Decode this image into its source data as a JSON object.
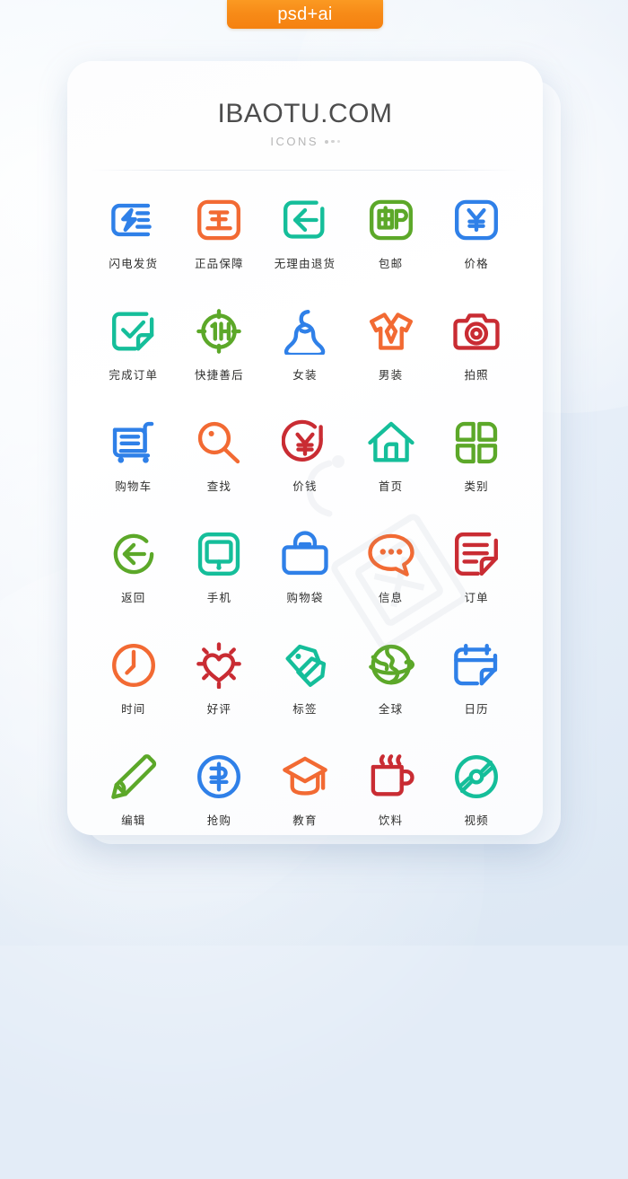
{
  "badge": {
    "label": "psd+ai",
    "color": "#f78b18"
  },
  "header": {
    "title": "IBAOTU.COM",
    "subtitle": "ICONS",
    "dots": "three-dots"
  },
  "palette": {
    "blue": "#2F80E8",
    "orange": "#F26A33",
    "teal": "#15BE9A",
    "green": "#5CA829",
    "red": "#C92C33"
  },
  "watermark": {
    "text": "图"
  },
  "grid": {
    "columns": 5,
    "rows": 6,
    "items": [
      {
        "label": "闪电发货",
        "icon": "flash-delivery-icon",
        "color": "#2F80E8"
      },
      {
        "label": "正品保障",
        "icon": "genuine-guarantee-icon",
        "color": "#F26A33"
      },
      {
        "label": "无理由退货",
        "icon": "return-arrow-icon",
        "color": "#15BE9A"
      },
      {
        "label": "包邮",
        "icon": "free-shipping-icon",
        "color": "#5CA829"
      },
      {
        "label": "价格",
        "icon": "price-yen-icon",
        "color": "#2F80E8"
      },
      {
        "label": "完成订单",
        "icon": "order-complete-icon",
        "color": "#15BE9A"
      },
      {
        "label": "快捷善后",
        "icon": "one-hour-icon",
        "color": "#5CA829"
      },
      {
        "label": "女装",
        "icon": "dress-icon",
        "color": "#2F80E8"
      },
      {
        "label": "男装",
        "icon": "shirt-icon",
        "color": "#F26A33"
      },
      {
        "label": "拍照",
        "icon": "camera-icon",
        "color": "#C92C33"
      },
      {
        "label": "购物车",
        "icon": "shopping-cart-icon",
        "color": "#2F80E8"
      },
      {
        "label": "查找",
        "icon": "search-icon",
        "color": "#F26A33"
      },
      {
        "label": "价钱",
        "icon": "yen-circle-icon",
        "color": "#C92C33"
      },
      {
        "label": "首页",
        "icon": "home-icon",
        "color": "#15BE9A"
      },
      {
        "label": "类别",
        "icon": "category-grid-icon",
        "color": "#5CA829"
      },
      {
        "label": "返回",
        "icon": "back-circle-icon",
        "color": "#5CA829"
      },
      {
        "label": "手机",
        "icon": "phone-icon",
        "color": "#15BE9A"
      },
      {
        "label": "购物袋",
        "icon": "shopping-bag-icon",
        "color": "#2F80E8"
      },
      {
        "label": "信息",
        "icon": "message-bubble-icon",
        "color": "#F26A33"
      },
      {
        "label": "订单",
        "icon": "order-list-icon",
        "color": "#C92C33"
      },
      {
        "label": "时间",
        "icon": "clock-icon",
        "color": "#F26A33"
      },
      {
        "label": "好评",
        "icon": "heart-rating-icon",
        "color": "#C92C33"
      },
      {
        "label": "标签",
        "icon": "tags-icon",
        "color": "#15BE9A"
      },
      {
        "label": "全球",
        "icon": "globe-icon",
        "color": "#5CA829"
      },
      {
        "label": "日历",
        "icon": "calendar-icon",
        "color": "#2F80E8"
      },
      {
        "label": "编辑",
        "icon": "edit-pencil-icon",
        "color": "#5CA829"
      },
      {
        "label": "抢购",
        "icon": "flash-sale-icon",
        "color": "#2F80E8"
      },
      {
        "label": "教育",
        "icon": "graduation-cap-icon",
        "color": "#F26A33"
      },
      {
        "label": "饮料",
        "icon": "drink-cup-icon",
        "color": "#C92C33"
      },
      {
        "label": "视频",
        "icon": "video-disc-icon",
        "color": "#15BE9A"
      }
    ]
  }
}
